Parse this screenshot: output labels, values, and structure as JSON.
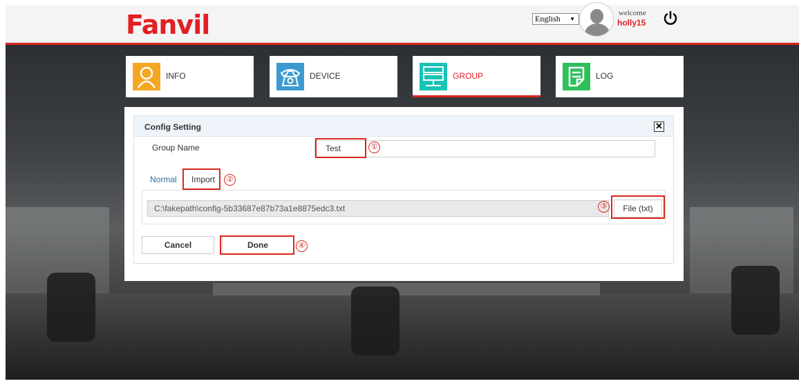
{
  "header": {
    "brand": "Fanvil",
    "language": "English",
    "welcome": "welcome",
    "username": "holly15"
  },
  "tabs": [
    {
      "label": "INFO",
      "icon": "user-icon",
      "color": "#f5a623"
    },
    {
      "label": "DEVICE",
      "icon": "phone-icon",
      "color": "#3d9ad1"
    },
    {
      "label": "GROUP",
      "icon": "server-icon",
      "color": "#19c3b5",
      "active": true
    },
    {
      "label": "LOG",
      "icon": "log-icon",
      "color": "#2fbf5a"
    }
  ],
  "dialog": {
    "title": "Config Setting",
    "group_name_label": "Group Name",
    "group_name_value": "Test",
    "mode_tabs": [
      "Normal",
      "Import"
    ],
    "file_path": "C:\\fakepath\\config-5b33687e87b73a1e8875edc3.txt",
    "file_button": "File (txt)",
    "cancel_label": "Cancel",
    "done_label": "Done"
  },
  "annotations": [
    "①",
    "②",
    "③",
    "④"
  ],
  "colors": {
    "accent_red": "#d9261c",
    "link_blue": "#2b6ca3"
  }
}
